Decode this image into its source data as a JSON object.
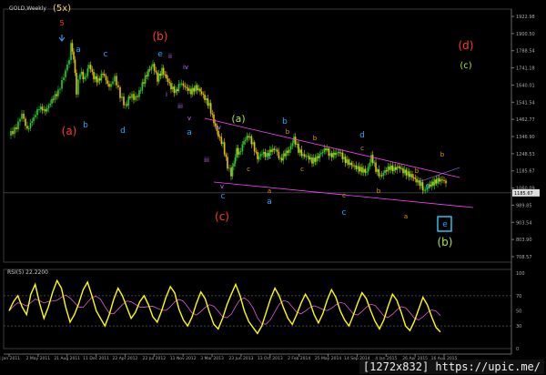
{
  "window": {
    "title": "GOLD,Weekly",
    "rsi_title": "RSI(5) 22.2200"
  },
  "watermark": "[1272x832] https://upic.me/",
  "colors": {
    "background": "#000000",
    "bull": "#2ecc2e",
    "bear": "#e8c000",
    "channel": "#ff40ff",
    "rsi_line": "#ffff00",
    "rsi_signal": "#ff66ff",
    "red": "#ff3b1e",
    "cyan": "#20a8ff",
    "green": "#a8e040",
    "orange": "#e39a00",
    "purple": "#c070ff",
    "price_box": "#dddddd"
  },
  "chart_data": [
    {
      "type": "candlestick",
      "title": "GOLD,Weekly",
      "ylim": [
        705.0,
        2085.0
      ],
      "y_ticks": [
        "1922.98",
        "1900.50",
        "1788.54",
        "1741.18",
        "1640.01",
        "1541.54",
        "1462.77",
        "1346.90",
        "1248.53",
        "1185.67",
        "1060.09",
        "989.85",
        "903.54",
        "803.90",
        "708.57"
      ],
      "x_ticks": [
        "4 Jan 2011",
        "2 May 2011",
        "21 Aug 2011",
        "11 Dec 2011",
        "22 Apr 2012",
        "22 Jul 2012",
        "11 Nov 2012",
        "3 Mar 2013",
        "23 Jun 2013",
        "13 Oct 2013",
        "2 Feb 2014",
        "25 May 2014",
        "14 Sep 2014",
        "4 Jan 2015",
        "26 Apr 2015",
        "16 Aug 2015"
      ],
      "current_price": "1185.67",
      "close_path": [
        [
          0,
          1400
        ],
        [
          8,
          1445
        ],
        [
          14,
          1520
        ],
        [
          20,
          1430
        ],
        [
          27,
          1500
        ],
        [
          33,
          1555
        ],
        [
          40,
          1535
        ],
        [
          47,
          1595
        ],
        [
          54,
          1640
        ],
        [
          60,
          1725
        ],
        [
          66,
          1820
        ],
        [
          68,
          1900
        ],
        [
          71,
          1825
        ],
        [
          74,
          1640
        ],
        [
          78,
          1750
        ],
        [
          83,
          1710
        ],
        [
          88,
          1790
        ],
        [
          93,
          1720
        ],
        [
          98,
          1700
        ],
        [
          103,
          1745
        ],
        [
          110,
          1665
        ],
        [
          116,
          1720
        ],
        [
          122,
          1620
        ],
        [
          128,
          1560
        ],
        [
          133,
          1620
        ],
        [
          139,
          1605
        ],
        [
          143,
          1640
        ],
        [
          148,
          1700
        ],
        [
          153,
          1755
        ],
        [
          158,
          1790
        ],
        [
          163,
          1710
        ],
        [
          168,
          1760
        ],
        [
          173,
          1715
        ],
        [
          178,
          1665
        ],
        [
          183,
          1640
        ],
        [
          188,
          1690
        ],
        [
          195,
          1660
        ],
        [
          200,
          1640
        ],
        [
          205,
          1665
        ],
        [
          210,
          1645
        ],
        [
          215,
          1605
        ],
        [
          220,
          1565
        ],
        [
          225,
          1475
        ],
        [
          230,
          1400
        ],
        [
          235,
          1350
        ],
        [
          240,
          1230
        ],
        [
          244,
          1190
        ],
        [
          247,
          1250
        ],
        [
          250,
          1320
        ],
        [
          253,
          1300
        ],
        [
          258,
          1370
        ],
        [
          263,
          1400
        ],
        [
          268,
          1350
        ],
        [
          273,
          1275
        ],
        [
          278,
          1305
        ],
        [
          283,
          1290
        ],
        [
          288,
          1320
        ],
        [
          293,
          1325
        ],
        [
          298,
          1265
        ],
        [
          303,
          1300
        ],
        [
          308,
          1320
        ],
        [
          313,
          1385
        ],
        [
          318,
          1320
        ],
        [
          323,
          1290
        ],
        [
          328,
          1285
        ],
        [
          333,
          1260
        ],
        [
          338,
          1275
        ],
        [
          343,
          1305
        ],
        [
          348,
          1330
        ],
        [
          353,
          1290
        ],
        [
          358,
          1300
        ],
        [
          363,
          1310
        ],
        [
          368,
          1270
        ],
        [
          373,
          1250
        ],
        [
          378,
          1235
        ],
        [
          383,
          1220
        ],
        [
          388,
          1210
        ],
        [
          393,
          1200
        ],
        [
          398,
          1285
        ],
        [
          403,
          1215
        ],
        [
          408,
          1175
        ],
        [
          413,
          1205
        ],
        [
          418,
          1225
        ],
        [
          423,
          1215
        ],
        [
          428,
          1230
        ],
        [
          433,
          1205
        ],
        [
          438,
          1190
        ],
        [
          443,
          1175
        ],
        [
          448,
          1150
        ],
        [
          453,
          1130
        ],
        [
          456,
          1095
        ],
        [
          461,
          1125
        ],
        [
          466,
          1140
        ],
        [
          471,
          1155
        ],
        [
          476,
          1155
        ],
        [
          480,
          1145
        ]
      ],
      "wave_labels": [
        {
          "text": "(5x)",
          "color": "yellow"
        },
        {
          "text": "5",
          "color": "red"
        },
        {
          "text": "a",
          "color": "cyan"
        },
        {
          "text": "c",
          "color": "cyan"
        },
        {
          "text": "b",
          "color": "cyan"
        },
        {
          "text": "d",
          "color": "cyan"
        },
        {
          "text": "(a)",
          "color": "red"
        },
        {
          "text": "(b)",
          "color": "red"
        },
        {
          "text": "e",
          "color": "cyan"
        },
        {
          "text": "ii",
          "color": "purple"
        },
        {
          "text": "iv",
          "color": "purple"
        },
        {
          "text": "i",
          "color": "purple"
        },
        {
          "text": "iii",
          "color": "purple"
        },
        {
          "text": "v",
          "color": "purple"
        },
        {
          "text": "a",
          "color": "cyan"
        },
        {
          "text": "iv",
          "color": "purple"
        },
        {
          "text": "iii",
          "color": "purple"
        },
        {
          "text": "v",
          "color": "purple"
        },
        {
          "text": "c",
          "color": "cyan"
        },
        {
          "text": "(c)",
          "color": "red"
        },
        {
          "text": "(a)",
          "color": "green"
        },
        {
          "text": "b",
          "color": "cyan"
        },
        {
          "text": "a",
          "color": "cyan"
        },
        {
          "text": "c",
          "color": "cyan"
        },
        {
          "text": "b",
          "color": "orange"
        },
        {
          "text": "c",
          "color": "orange"
        },
        {
          "text": "a",
          "color": "orange"
        },
        {
          "text": "b",
          "color": "orange"
        },
        {
          "text": "c",
          "color": "orange"
        },
        {
          "text": "d",
          "color": "cyan"
        },
        {
          "text": "c",
          "color": "orange"
        },
        {
          "text": "c",
          "color": "orange"
        },
        {
          "text": "b",
          "color": "orange"
        },
        {
          "text": "c",
          "color": "cyan"
        },
        {
          "text": "b",
          "color": "orange"
        },
        {
          "text": "b",
          "color": "orange"
        },
        {
          "text": "a",
          "color": "orange"
        },
        {
          "text": "c",
          "color": "cyan"
        },
        {
          "text": "e",
          "color": "cyan"
        },
        {
          "text": "(b)",
          "color": "green"
        },
        {
          "text": "(d)",
          "color": "red"
        },
        {
          "text": "(c)",
          "color": "green"
        }
      ]
    },
    {
      "type": "line",
      "title": "RSI(5) 22.2200",
      "ylim": [
        0,
        100
      ],
      "y_ticks": [
        "100",
        "70",
        "50",
        "30",
        "0"
      ],
      "series": [
        {
          "values": [
            50,
            62,
            70,
            55,
            45,
            72,
            85,
            60,
            40,
            55,
            75,
            90,
            80,
            55,
            35,
            45,
            60,
            78,
            88,
            70,
            50,
            40,
            30,
            45,
            65,
            80,
            70,
            55,
            40,
            48,
            62,
            70,
            58,
            42,
            35,
            50,
            68,
            82,
            74,
            52,
            38,
            30,
            42,
            60,
            75,
            66,
            48,
            32,
            26,
            40,
            58,
            72,
            85,
            70,
            50,
            36,
            28,
            20,
            30,
            48,
            66,
            80,
            70,
            54,
            40,
            32,
            45,
            60,
            72,
            62,
            45,
            34,
            46,
            64,
            78,
            68,
            50,
            38,
            30,
            44,
            60,
            74,
            66,
            50,
            36,
            26,
            38,
            56,
            72,
            64,
            48,
            30,
            24,
            36,
            52,
            68,
            58,
            42,
            28,
            22
          ]
        }
      ]
    }
  ]
}
